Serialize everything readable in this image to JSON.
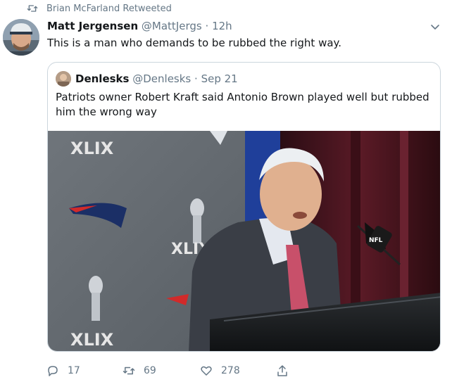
{
  "retweet_context": {
    "text": "Brian McFarland Retweeted"
  },
  "tweet": {
    "author_name": "Matt Jergensen",
    "author_handle": "@MattJergs",
    "separator": "·",
    "time": "12h",
    "text": "This is a man who demands to be rubbed the right way."
  },
  "quote": {
    "author_name": "Denlesks",
    "author_handle": "@Denlesks",
    "separator": "·",
    "time": "Sep 21",
    "text": "Patriots owner Robert Kraft said Antonio Brown played well but rubbed him the wrong way",
    "photo": {
      "backdrop_texts": [
        "XLIX",
        "XLIX",
        "XLIX"
      ],
      "mic_flag_text": "NFL"
    }
  },
  "actions": {
    "reply_count": "17",
    "retweet_count": "69",
    "like_count": "278"
  },
  "colors": {
    "secondary_text": "#657786",
    "border": "#ccd6dd",
    "primary_text": "#14171a"
  },
  "icons": {
    "retweet_context": "retweet-icon",
    "caret": "chevron-down-icon",
    "reply": "reply-icon",
    "retweet": "retweet-icon",
    "like": "heart-icon",
    "share": "share-icon"
  }
}
